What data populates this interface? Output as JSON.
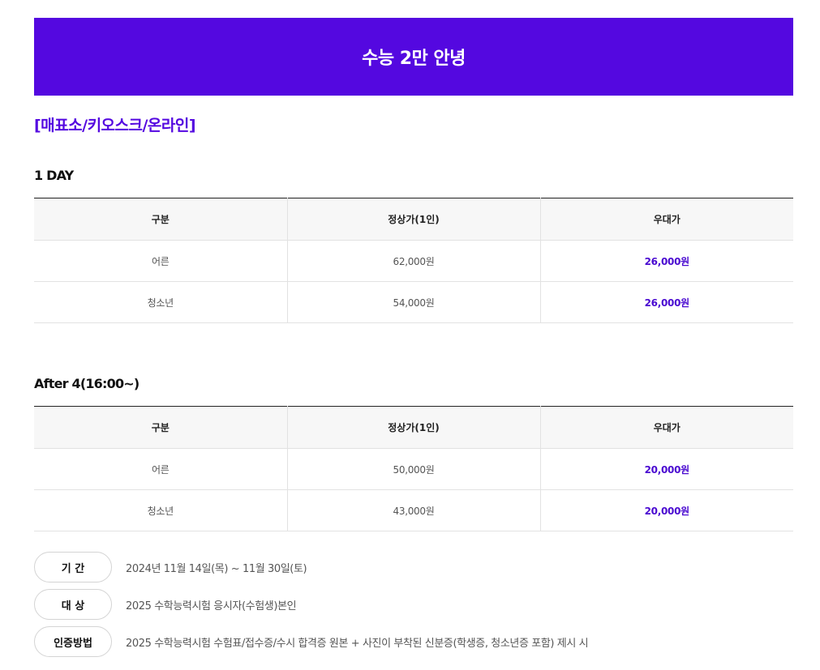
{
  "colors": {
    "brand": "#5408e0",
    "promo_text": "#4a0ad1"
  },
  "banner": {
    "title": "수능 2만 안녕"
  },
  "section_label": "[매표소/키오스크/온라인]",
  "tables": [
    {
      "title": "1 DAY",
      "headers": [
        "구분",
        "정상가(1인)",
        "우대가"
      ],
      "rows": [
        {
          "category": "어른",
          "regular": "62,000원",
          "promo": "26,000원"
        },
        {
          "category": "청소년",
          "regular": "54,000원",
          "promo": "26,000원"
        }
      ]
    },
    {
      "title": "After 4(16:00~)",
      "headers": [
        "구분",
        "정상가(1인)",
        "우대가"
      ],
      "rows": [
        {
          "category": "어른",
          "regular": "50,000원",
          "promo": "20,000원"
        },
        {
          "category": "청소년",
          "regular": "43,000원",
          "promo": "20,000원"
        }
      ]
    }
  ],
  "info": [
    {
      "label": "기 간",
      "value": "2024년 11월 14일(목) ~ 11월 30일(토)"
    },
    {
      "label": "대 상",
      "value": "2025 수학능력시험 응시자(수험생)본인"
    },
    {
      "label": "인증방법",
      "value": "2025 수학능력시험 수험표/접수증/수시 합격증 원본 + 사진이 부착된 신분증(학생증, 청소년증 포함) 제시 시"
    }
  ]
}
